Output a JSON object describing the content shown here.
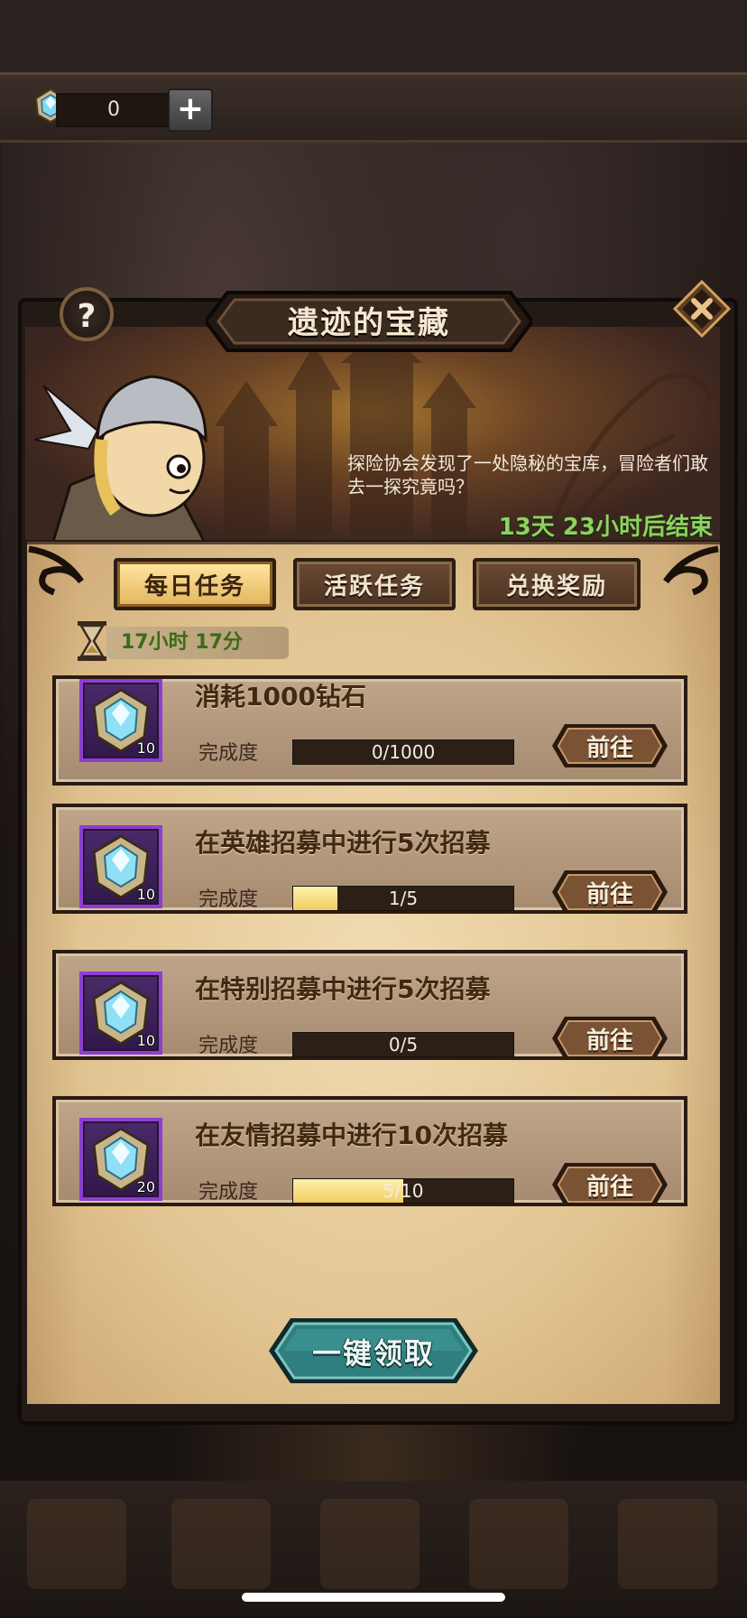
{
  "header": {
    "gem_count": "0",
    "gem_icon": "diamond-gem-icon",
    "add_icon": "plus-icon"
  },
  "event": {
    "title": "遗迹的宝藏",
    "description": "探险协会发现了一处隐秘的宝库，冒险者们敢去一探究竟吗？",
    "time_remaining": "13天 23小时后结束",
    "help_label": "?",
    "close_icon": "close-icon"
  },
  "tabs": [
    {
      "label": "每日任务",
      "active": true
    },
    {
      "label": "活跃任务",
      "active": false
    },
    {
      "label": "兑换奖励",
      "active": false
    }
  ],
  "daily_countdown": "17小时 17分",
  "progress_label": "完成度",
  "go_label": "前往",
  "tasks": [
    {
      "title": "消耗1000钻石",
      "reward_qty": "10",
      "progress_text": "0/1000",
      "progress": 0
    },
    {
      "title": "在英雄招募中进行5次招募",
      "reward_qty": "10",
      "progress_text": "1/5",
      "progress": 0.2
    },
    {
      "title": "在特别招募中进行5次招募",
      "reward_qty": "10",
      "progress_text": "0/5",
      "progress": 0
    },
    {
      "title": "在友情招募中进行10次招募",
      "reward_qty": "20",
      "progress_text": "5/10",
      "progress": 0.5
    }
  ],
  "claim_all_label": "一键领取",
  "colors": {
    "progress_fill": "#f2cd62",
    "timer_green": "#8fd15f",
    "reward_border": "#8c3fd0",
    "claim_teal": "#2f7f80"
  }
}
